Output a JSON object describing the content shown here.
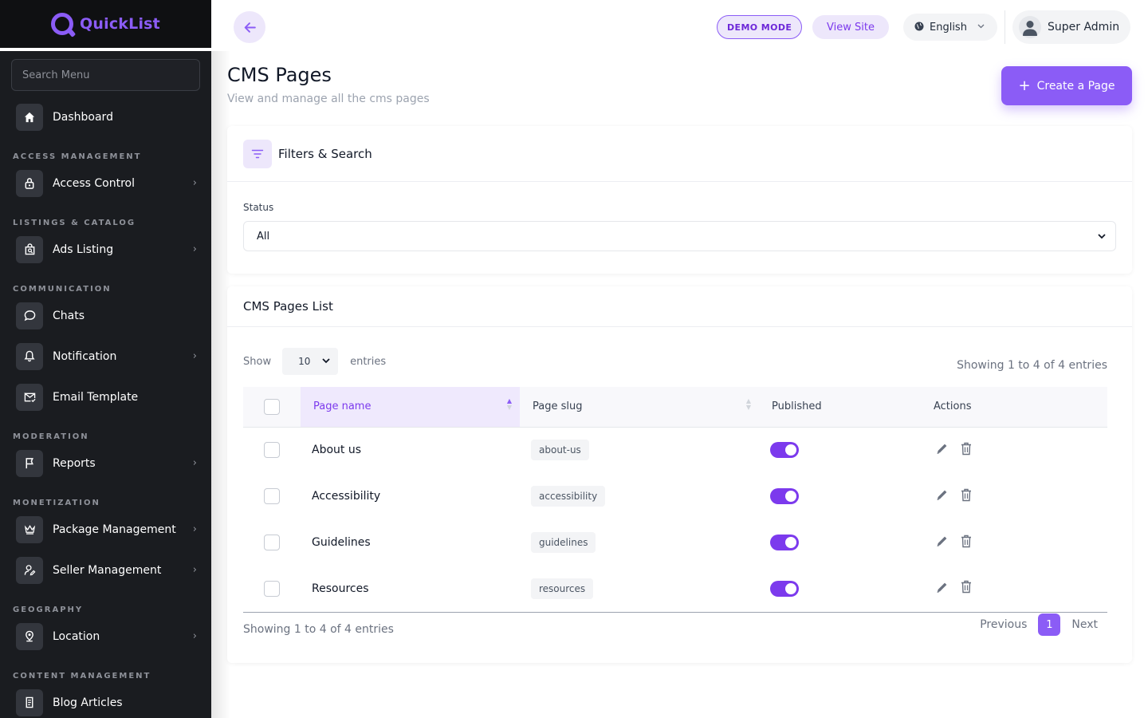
{
  "brand": {
    "name": "QuickList"
  },
  "sidebar": {
    "search_placeholder": "Search Menu",
    "dashboard": {
      "label": "Dashboard",
      "icon": "home-icon"
    },
    "sections": {
      "access": "ACCESS MANAGEMENT",
      "listings": "LISTINGS & CATALOG",
      "communication": "COMMUNICATION",
      "moderation": "MODERATION",
      "monetization": "MONETIZATION",
      "geography": "GEOGRAPHY",
      "content": "CONTENT MANAGEMENT"
    },
    "items": {
      "access_control": "Access Control",
      "ads_listing": "Ads Listing",
      "chats": "Chats",
      "notification": "Notification",
      "email_template": "Email Template",
      "reports": "Reports",
      "package_management": "Package Management",
      "seller_management": "Seller Management",
      "location": "Location",
      "blog_articles": "Blog Articles"
    }
  },
  "header": {
    "demo_badge": "DEMO MODE",
    "view_site": "View Site",
    "language": "English",
    "user_name": "Super Admin"
  },
  "page": {
    "title": "CMS Pages",
    "subtitle": "View and manage all the cms pages",
    "create_button": "Create a Page"
  },
  "filters": {
    "title": "Filters & Search",
    "status_label": "Status",
    "status_value": "All"
  },
  "list": {
    "title": "CMS Pages List",
    "show_label": "Show",
    "entries_label": "entries",
    "page_length": "10",
    "info": "Showing 1 to 4 of 4 entries",
    "columns": {
      "name": "Page name",
      "slug": "Page slug",
      "published": "Published",
      "actions": "Actions"
    },
    "rows": [
      {
        "name": "About us",
        "slug": "about-us",
        "published": true
      },
      {
        "name": "Accessibility",
        "slug": "accessibility",
        "published": true
      },
      {
        "name": "Guidelines",
        "slug": "guidelines",
        "published": true
      },
      {
        "name": "Resources",
        "slug": "resources",
        "published": true
      }
    ],
    "pagination": {
      "previous": "Previous",
      "current": "1",
      "next": "Next"
    }
  },
  "colors": {
    "accent": "#8b5cf6",
    "accent_light": "#ede7fb",
    "sidebar_bg": "#1a1c20"
  }
}
